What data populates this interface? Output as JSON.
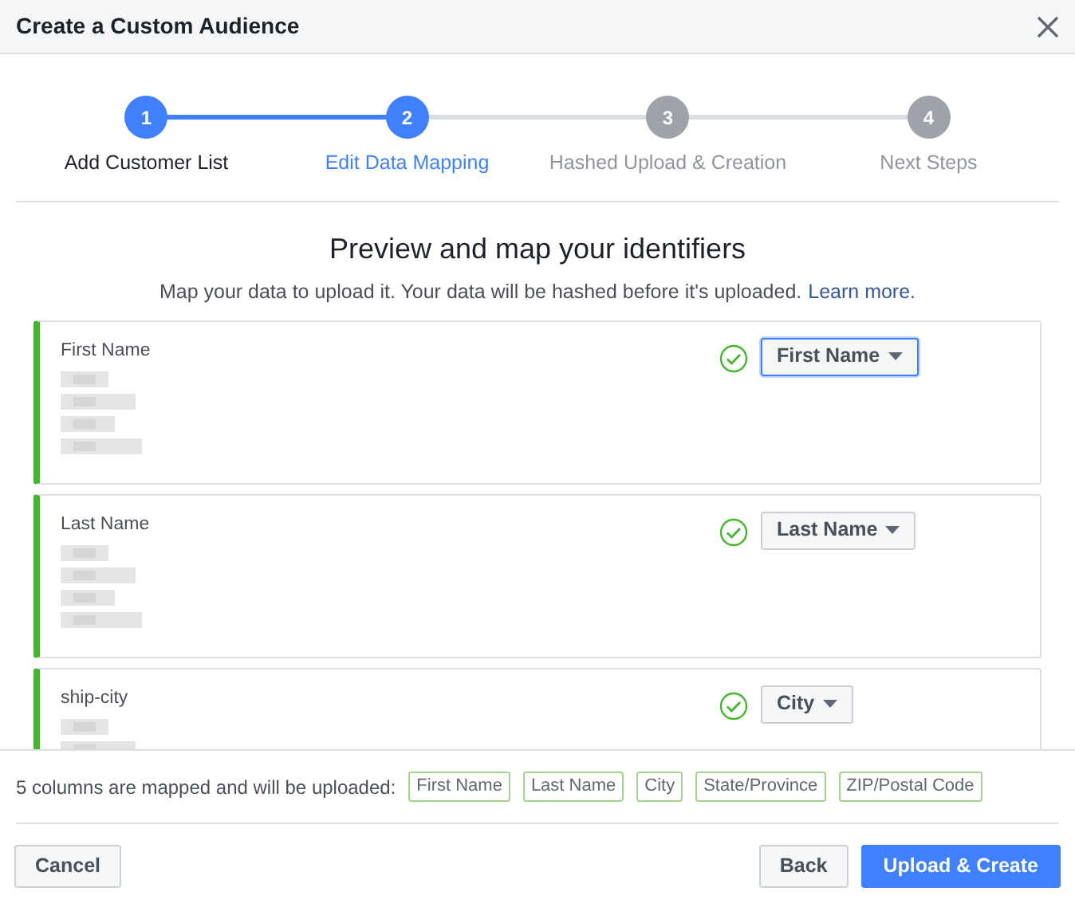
{
  "window": {
    "title": "Create a Custom Audience"
  },
  "steps": [
    {
      "number": "1",
      "label": "Add Customer List",
      "completed": true,
      "selected": false
    },
    {
      "number": "2",
      "label": "Edit Data Mapping",
      "completed": false,
      "selected": true
    },
    {
      "number": "3",
      "label": "Hashed Upload & Creation",
      "completed": false,
      "selected": false
    },
    {
      "number": "4",
      "label": "Next Steps",
      "completed": false,
      "selected": false
    }
  ],
  "heading": "Preview and map your identifiers",
  "subtitle": "Map your data to upload it. Your data will be hashed before it's uploaded.",
  "learn_more": "Learn more.",
  "mappings": [
    {
      "column": "First Name",
      "mapped": true,
      "field": "First Name",
      "focused": true
    },
    {
      "column": "Last Name",
      "mapped": true,
      "field": "Last Name",
      "focused": false
    },
    {
      "column": "ship-city",
      "mapped": true,
      "field": "City",
      "focused": false
    }
  ],
  "summary": {
    "text": "5 columns are mapped and will be uploaded:",
    "tags": [
      "First Name",
      "Last Name",
      "City",
      "State/Province",
      "ZIP/Postal Code"
    ]
  },
  "buttons": {
    "cancel": "Cancel",
    "back": "Back",
    "primary": "Upload & Create"
  }
}
